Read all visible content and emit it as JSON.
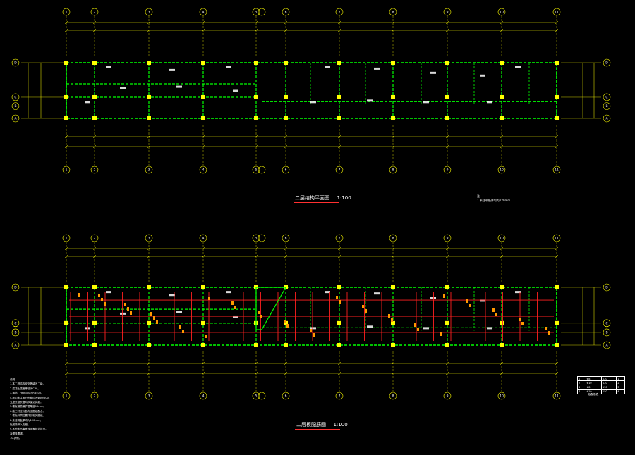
{
  "drawing": {
    "colors": {
      "background": "#000000",
      "axis_bubble": "#ffff00",
      "dimension": "#ffff00",
      "beam": "#00ff00",
      "column": "#ffff00",
      "rebar": "#ff2020",
      "text": "#ffffff",
      "annotation_orange": "#ff9900"
    },
    "top_plan": {
      "title": "二层结构平面图",
      "scale": "1:100",
      "note_title": "注:",
      "note_text": "1.未注明板厚均为120mm"
    },
    "bottom_plan": {
      "title": "二层板配筋图",
      "scale": "1:100"
    },
    "top_axes": [
      "1",
      "2",
      "3",
      "4",
      "5",
      "6",
      "7",
      "8",
      "9",
      "10",
      "11"
    ],
    "bottom_axes": [
      "1",
      "2",
      "3",
      "4",
      "5",
      "6",
      "7",
      "8",
      "9",
      "10",
      "11"
    ],
    "row_axes": [
      "D",
      "C",
      "B",
      "A"
    ],
    "notes": {
      "heading": "说明",
      "items": [
        "1.本工程结构安全等级为二级。",
        "2.混凝土强度等级为C30。",
        "3.钢筋：HPB300,HRB400。",
        "4.板内未注明分布筋均为Φ6@200。",
        "  支座负筋长度均从梁边算起。",
        "5.楼板钢筋保护层厚度15mm。",
        "6.施工时应与各专业图纸配合。",
        "7.楼板开洞位置详见相关图纸。",
        "8.未注明板厚均为120mm，",
        "  板底筋伸入支座。",
        "9.其他未尽事宜按国家规范执行。",
        "  及图集要求。",
        "10.其他。"
      ]
    },
    "legend": {
      "rows": [
        [
          "1",
          "Φ8",
          "120",
          "1"
        ],
        [
          "2",
          "Φ10",
          "120",
          "2"
        ],
        [
          "3",
          "Φ8",
          "150",
          "3"
        ],
        [
          "4",
          "Φ10",
          "150",
          "4"
        ]
      ],
      "caption": "板配筋表"
    }
  }
}
